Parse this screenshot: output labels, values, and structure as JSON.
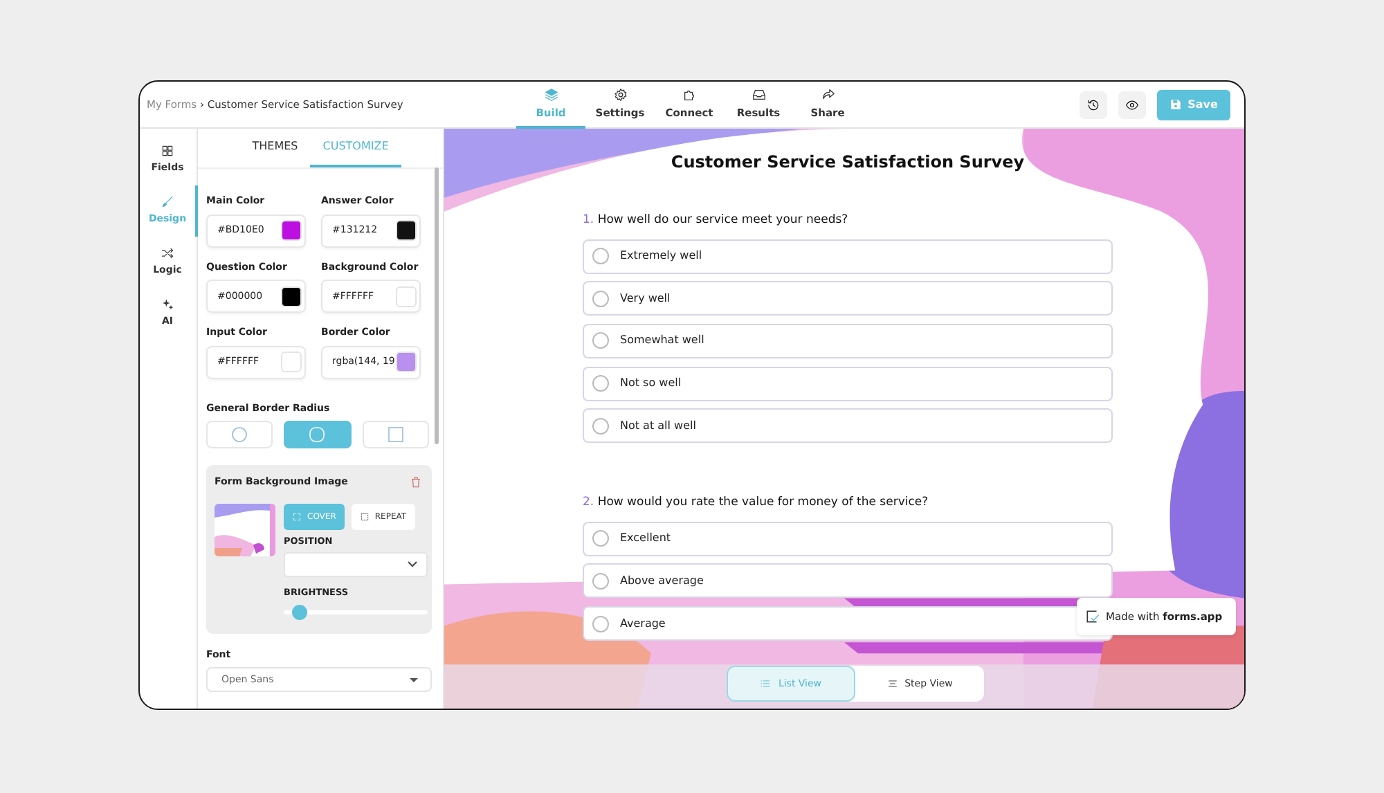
{
  "breadcrumb": {
    "parent": "My Forms",
    "separator": "›",
    "current": "Customer Service Satisfaction Survey"
  },
  "nav_tabs": [
    {
      "label": "Build",
      "kind": "layers",
      "selected": true
    },
    {
      "label": "Settings",
      "kind": "gear",
      "selected": false
    },
    {
      "label": "Connect",
      "kind": "puzzle",
      "selected": false
    },
    {
      "label": "Results",
      "kind": "inbox",
      "selected": false
    },
    {
      "label": "Share",
      "kind": "share",
      "selected": false
    }
  ],
  "save_button": {
    "label": "Save"
  },
  "sidebar": [
    {
      "label": "Fields",
      "kind": "grid",
      "selected": false
    },
    {
      "label": "Design",
      "kind": "brush",
      "selected": true
    },
    {
      "label": "Logic",
      "kind": "shuffle",
      "selected": false
    },
    {
      "label": "AI",
      "kind": "sparkle",
      "selected": false
    }
  ],
  "panel_tabs": [
    {
      "label": "THEMES",
      "selected": false
    },
    {
      "label": "CUSTOMIZE",
      "selected": true
    }
  ],
  "color_fields": [
    {
      "label": "Main Color",
      "value": "#BD10E0",
      "color": "#bd10e0"
    },
    {
      "label": "Answer Color",
      "value": "#131212",
      "color": "#131212"
    },
    {
      "label": "Question Color",
      "value": "#000000",
      "color": "#000000"
    },
    {
      "label": "Background Color",
      "value": "#FFFFFF",
      "color": "#ffffff"
    },
    {
      "label": "Input Color",
      "value": "#FFFFFF",
      "color": "#ffffff"
    },
    {
      "label": "Border Color",
      "value": "rgba(144, 19",
      "color": "#b98ff0"
    }
  ],
  "border_radius": {
    "label": "General Border Radius",
    "options": [
      {
        "kind": "circle",
        "selected": false
      },
      {
        "kind": "rounded",
        "selected": true
      },
      {
        "kind": "square",
        "selected": false
      }
    ]
  },
  "background_image": {
    "title": "Form Background Image",
    "modes": [
      {
        "label": "COVER",
        "kind": "cover",
        "selected": true
      },
      {
        "label": "REPEAT",
        "kind": "repeat",
        "selected": false
      }
    ],
    "position_label": "POSITION",
    "brightness_label": "BRIGHTNESS",
    "brightness": {
      "level": 0.08
    }
  },
  "font": {
    "label": "Font",
    "value": "Open Sans"
  },
  "form": {
    "title": "Customer Service Satisfaction Survey",
    "questions": [
      {
        "number": "1.",
        "text": "How well do our service meet your needs?",
        "options": [
          {
            "label": "Extremely well",
            "selected": false
          },
          {
            "label": "Very well",
            "selected": false
          },
          {
            "label": "Somewhat well",
            "selected": false
          },
          {
            "label": "Not so well",
            "selected": false
          },
          {
            "label": "Not at all well",
            "selected": false
          }
        ]
      },
      {
        "number": "2.",
        "text": "How would you rate the value for money of the service?",
        "options": [
          {
            "label": "Excellent",
            "selected": false
          },
          {
            "label": "Above average",
            "selected": false
          },
          {
            "label": "Average",
            "selected": false
          }
        ]
      }
    ]
  },
  "view_toggle": [
    {
      "label": "List View",
      "kind": "list",
      "selected": true
    },
    {
      "label": "Step View",
      "kind": "step",
      "selected": false
    }
  ],
  "badge": {
    "text": "Made with **forms.app**"
  }
}
